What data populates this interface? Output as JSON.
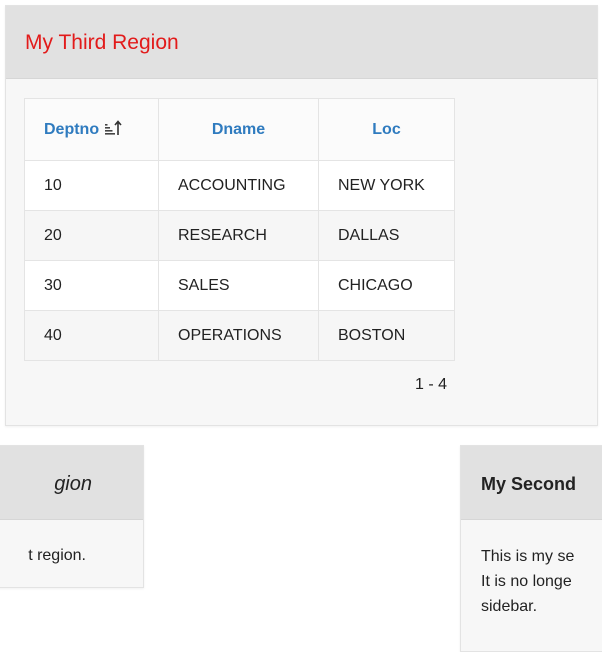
{
  "region3": {
    "title": "My Third Region",
    "columns": [
      "Deptno",
      "Dname",
      "Loc"
    ],
    "rows": [
      [
        "10",
        "ACCOUNTING",
        "NEW YORK"
      ],
      [
        "20",
        "RESEARCH",
        "DALLAS"
      ],
      [
        "30",
        "SALES",
        "CHICAGO"
      ],
      [
        "40",
        "OPERATIONS",
        "BOSTON"
      ]
    ],
    "pagination": "1 - 4",
    "sort_icon": "sort-ascending-icon"
  },
  "region1": {
    "title": "gion",
    "body": "t region."
  },
  "region2": {
    "title": "My Second",
    "lines": [
      "This is my se",
      "It is no longe",
      "sidebar."
    ]
  },
  "colors": {
    "region_title_red": "#e21b1b",
    "column_header_blue": "#2f7bbf",
    "header_bg": "#e1e1e1",
    "region_bg": "#f7f7f7"
  }
}
